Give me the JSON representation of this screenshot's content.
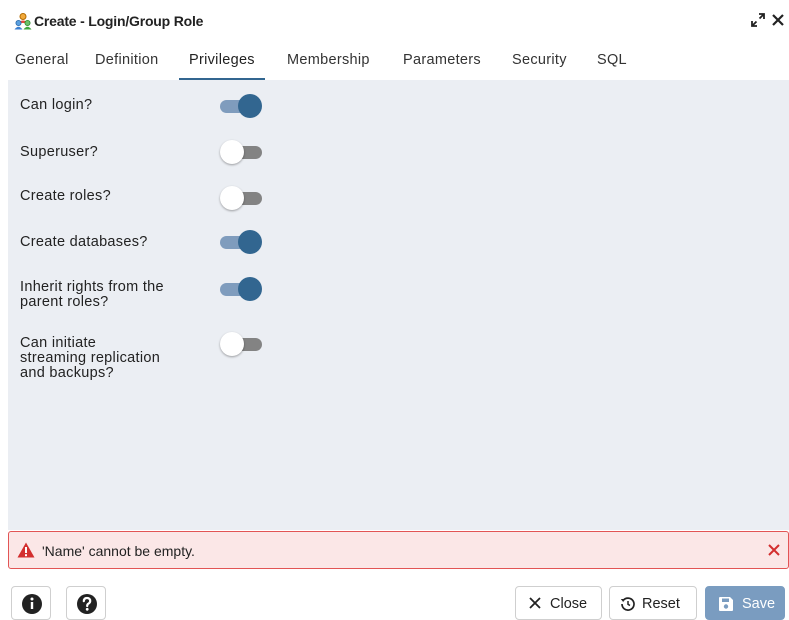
{
  "window": {
    "title": "Create - Login/Group Role"
  },
  "tabs": [
    {
      "label": "General"
    },
    {
      "label": "Definition"
    },
    {
      "label": "Privileges",
      "active": true
    },
    {
      "label": "Membership"
    },
    {
      "label": "Parameters"
    },
    {
      "label": "Security"
    },
    {
      "label": "SQL"
    }
  ],
  "privileges": [
    {
      "label_lines": [
        "Can login?"
      ],
      "on": true
    },
    {
      "label_lines": [
        "Superuser?"
      ],
      "on": false
    },
    {
      "label_lines": [
        "Create roles?"
      ],
      "on": false
    },
    {
      "label_lines": [
        "Create databases?"
      ],
      "on": true
    },
    {
      "label_lines": [
        "Inherit rights from the",
        "parent roles?"
      ],
      "on": true
    },
    {
      "label_lines": [
        "Can initiate",
        "streaming replication",
        "and backups?"
      ],
      "on": false
    }
  ],
  "error": {
    "message": "'Name' cannot be empty.",
    "color": "#d32f2f"
  },
  "footer": {
    "close_label": "Close",
    "reset_label": "Reset",
    "save_label": "Save"
  },
  "colors": {
    "accent": "#326690",
    "toggle_on_track": "#7f9cbd",
    "panel_bg": "#ebeef3",
    "save_bg": "#7a9cc0"
  }
}
